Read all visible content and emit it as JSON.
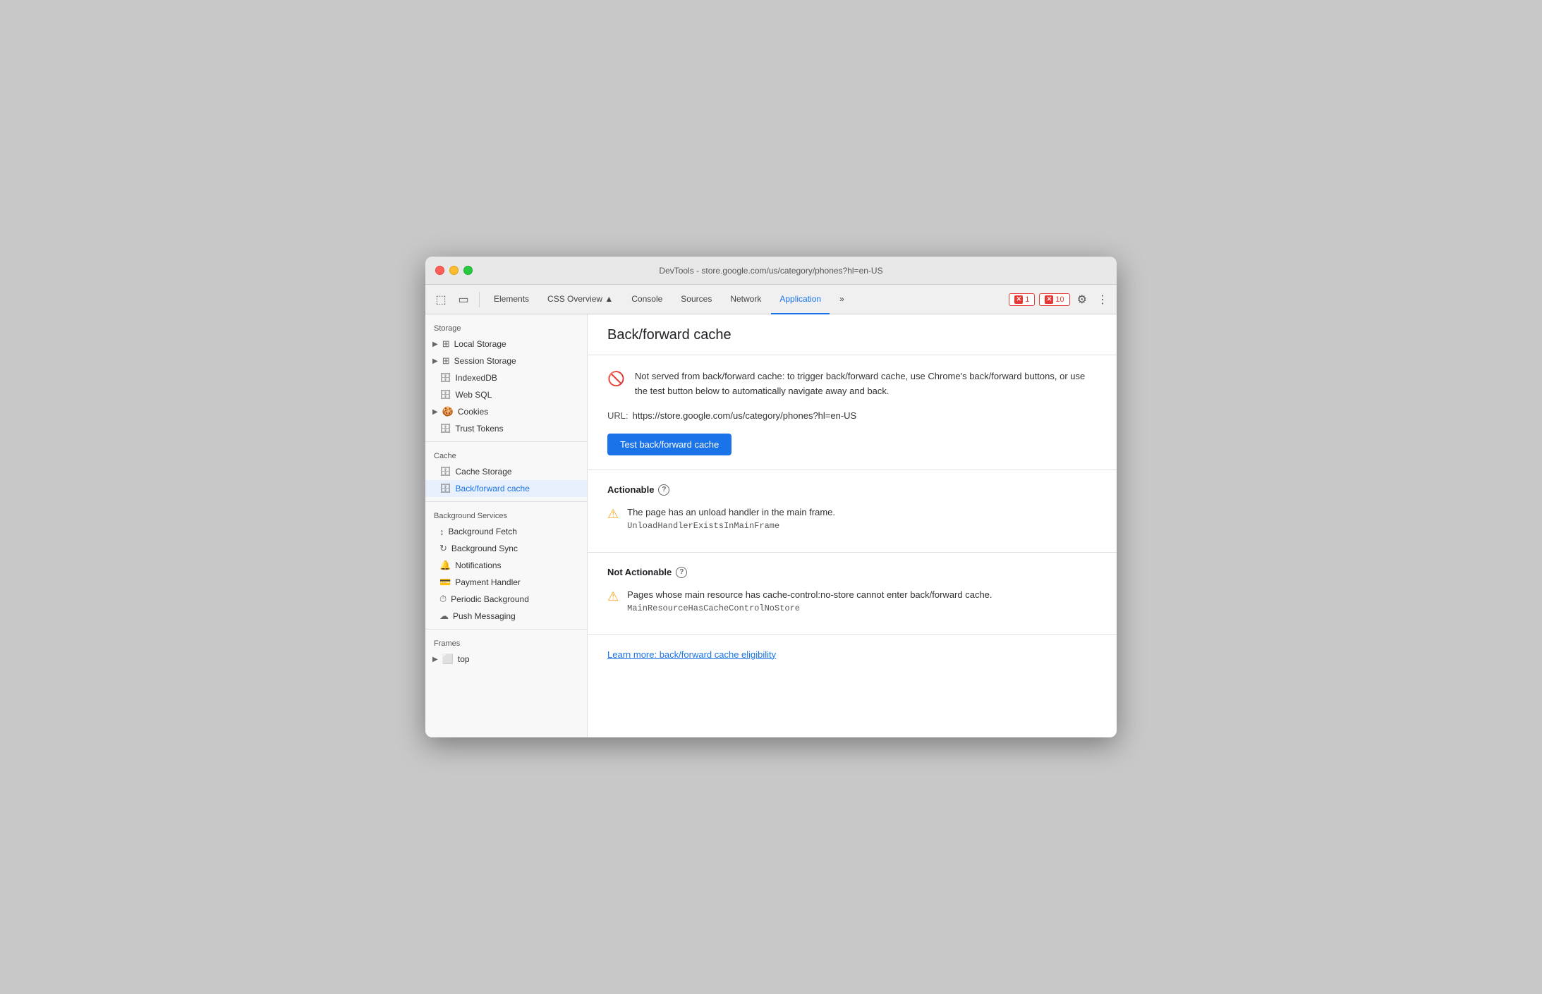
{
  "window": {
    "title": "DevTools - store.google.com/us/category/phones?hl=en-US"
  },
  "toolbar": {
    "tabs": [
      {
        "label": "Elements",
        "active": false
      },
      {
        "label": "CSS Overview ▲",
        "active": false
      },
      {
        "label": "Console",
        "active": false
      },
      {
        "label": "Sources",
        "active": false
      },
      {
        "label": "Network",
        "active": false
      },
      {
        "label": "Application",
        "active": true
      },
      {
        "label": "»",
        "active": false
      }
    ],
    "error_count": "1",
    "warning_count": "10"
  },
  "sidebar": {
    "storage_header": "Storage",
    "items": [
      {
        "label": "Local Storage",
        "icon": "grid",
        "has_arrow": true,
        "active": false
      },
      {
        "label": "Session Storage",
        "icon": "grid",
        "has_arrow": true,
        "active": false
      },
      {
        "label": "IndexedDB",
        "icon": "db",
        "has_arrow": false,
        "active": false
      },
      {
        "label": "Web SQL",
        "icon": "db",
        "has_arrow": false,
        "active": false
      },
      {
        "label": "Cookies",
        "icon": "cookie",
        "has_arrow": true,
        "active": false
      },
      {
        "label": "Trust Tokens",
        "icon": "db",
        "has_arrow": false,
        "active": false
      }
    ],
    "cache_header": "Cache",
    "cache_items": [
      {
        "label": "Cache Storage",
        "icon": "db",
        "active": false
      },
      {
        "label": "Back/forward cache",
        "icon": "db",
        "active": true
      }
    ],
    "bg_services_header": "Background Services",
    "bg_items": [
      {
        "label": "Background Fetch",
        "icon": "arrows"
      },
      {
        "label": "Background Sync",
        "icon": "sync"
      },
      {
        "label": "Notifications",
        "icon": "bell"
      },
      {
        "label": "Payment Handler",
        "icon": "card"
      },
      {
        "label": "Periodic Background",
        "icon": "clock"
      },
      {
        "label": "Push Messaging",
        "icon": "cloud"
      }
    ],
    "frames_header": "Frames",
    "frames_items": [
      {
        "label": "top",
        "has_arrow": true
      }
    ]
  },
  "main": {
    "page_title": "Back/forward cache",
    "info_message": "Not served from back/forward cache: to trigger back/forward cache, use Chrome's back/forward buttons, or use the test button below to automatically navigate away and back.",
    "url_label": "URL:",
    "url_value": "https://store.google.com/us/category/phones?hl=en-US",
    "test_button_label": "Test back/forward cache",
    "actionable_title": "Actionable",
    "actionable_issue": "The page has an unload handler in the main frame.",
    "actionable_code": "UnloadHandlerExistsInMainFrame",
    "not_actionable_title": "Not Actionable",
    "not_actionable_issue": "Pages whose main resource has cache-control:no-store cannot enter back/forward cache.",
    "not_actionable_code": "MainResourceHasCacheControlNoStore",
    "learn_more_link": "Learn more: back/forward cache eligibility"
  }
}
